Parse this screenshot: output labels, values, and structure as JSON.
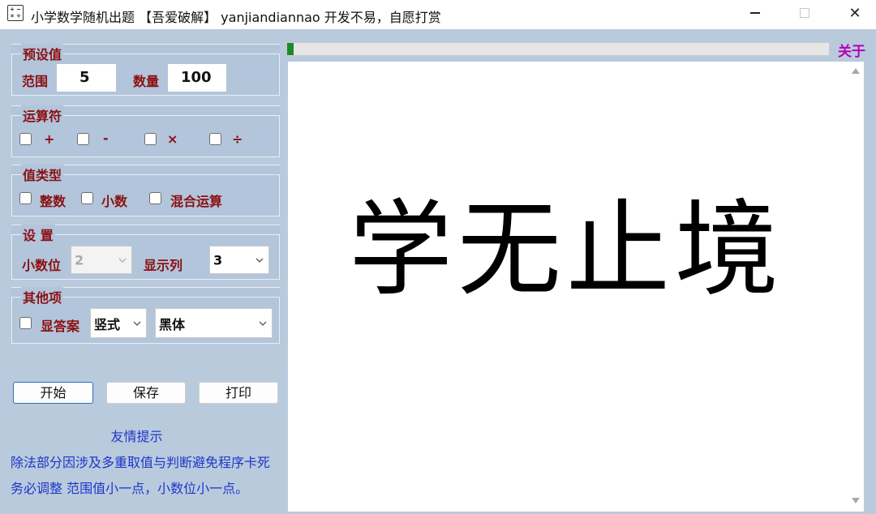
{
  "window": {
    "title": "小学数学随机出题 【吾爱破解】 yanjiandiannao 开发不易，自愿打赏",
    "icon_glyphs": [
      "+",
      "−",
      "×",
      "÷"
    ],
    "close_glyph": "✕"
  },
  "presets": {
    "group_title": "预设值",
    "range_label": "范围",
    "range_value": "5",
    "count_label": "数量",
    "count_value": "100"
  },
  "operators": {
    "group_title": "运算符",
    "items": [
      {
        "label": "+",
        "checked": false
      },
      {
        "label": "-",
        "checked": false
      },
      {
        "label": "×",
        "checked": false
      },
      {
        "label": "÷",
        "checked": false
      }
    ]
  },
  "value_type": {
    "group_title": "值类型",
    "items": [
      {
        "label": "整数",
        "checked": false
      },
      {
        "label": "小数",
        "checked": false
      },
      {
        "label": "混合运算",
        "checked": false
      }
    ]
  },
  "settings": {
    "group_title": "设 置",
    "decimal_label": "小数位",
    "decimal_value": "2",
    "columns_label": "显示列",
    "columns_value": "3"
  },
  "other": {
    "group_title": "其他项",
    "show_answer_label": "显答案",
    "show_answer_checked": false,
    "format_value": "竖式",
    "font_value": "黑体"
  },
  "buttons": {
    "start": "开始",
    "save": "保存",
    "print": "打印"
  },
  "tips": {
    "title": "友情提示",
    "line1": "除法部分因涉及多重取值与判断避免程序卡死",
    "line2": "务必调整 范围值小一点，小数位小一点。"
  },
  "progress": {
    "fraction": 0.01
  },
  "about_label": "关于",
  "display_text": "学无止境",
  "colors": {
    "panel": "#b9cadd",
    "label": "#8b1010",
    "tip": "#1d36c8",
    "about": "#b600b6",
    "progress": "#1b8a2b"
  }
}
